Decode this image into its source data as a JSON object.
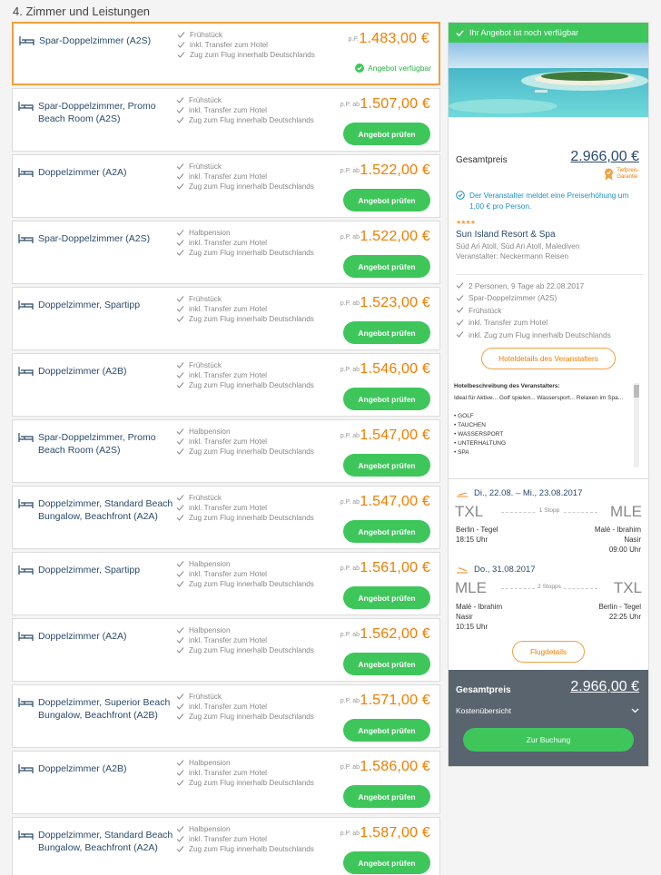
{
  "section_title": "4. Zimmer und Leistungen",
  "offers": [
    {
      "name": "Spar-Doppelzimmer (A2S)",
      "features": [
        "Frühstück",
        "inkl. Transfer zum Hotel",
        "Zug zum Flug innerhalb Deutschlands"
      ],
      "price_note": "p.P.",
      "price": "1.483,00 €",
      "status": "Angebot verfügbar"
    },
    {
      "name": "Spar-Doppelzimmer, Promo Beach Room (A2S)",
      "features": [
        "Frühstück",
        "inkl. Transfer zum Hotel",
        "Zug zum Flug innerhalb Deutschlands"
      ],
      "price_note": "p.P. ab",
      "price": "1.507,00 €",
      "button": "Angebot prüfen"
    },
    {
      "name": "Doppelzimmer (A2A)",
      "features": [
        "Frühstück",
        "inkl. Transfer zum Hotel",
        "Zug zum Flug innerhalb Deutschlands"
      ],
      "price_note": "p.P. ab",
      "price": "1.522,00 €",
      "button": "Angebot prüfen"
    },
    {
      "name": "Spar-Doppelzimmer (A2S)",
      "features": [
        "Halbpension",
        "inkl. Transfer zum Hotel",
        "Zug zum Flug innerhalb Deutschlands"
      ],
      "price_note": "p.P. ab",
      "price": "1.522,00 €",
      "button": "Angebot prüfen"
    },
    {
      "name": "Doppelzimmer, Spartipp",
      "features": [
        "Frühstück",
        "inkl. Transfer zum Hotel",
        "Zug zum Flug innerhalb Deutschlands"
      ],
      "price_note": "p.P. ab",
      "price": "1.523,00 €",
      "button": "Angebot prüfen"
    },
    {
      "name": "Doppelzimmer (A2B)",
      "features": [
        "Frühstück",
        "inkl. Transfer zum Hotel",
        "Zug zum Flug innerhalb Deutschlands"
      ],
      "price_note": "p.P. ab",
      "price": "1.546,00 €",
      "button": "Angebot prüfen"
    },
    {
      "name": "Spar-Doppelzimmer, Promo Beach Room (A2S)",
      "features": [
        "Halbpension",
        "inkl. Transfer zum Hotel",
        "Zug zum Flug innerhalb Deutschlands"
      ],
      "price_note": "p.P. ab",
      "price": "1.547,00 €",
      "button": "Angebot prüfen"
    },
    {
      "name": "Doppelzimmer, Standard Beach Bungalow, Beachfront (A2A)",
      "features": [
        "Frühstück",
        "inkl. Transfer zum Hotel",
        "Zug zum Flug innerhalb Deutschlands"
      ],
      "price_note": "p.P. ab",
      "price": "1.547,00 €",
      "button": "Angebot prüfen"
    },
    {
      "name": "Doppelzimmer, Spartipp",
      "features": [
        "Halbpension",
        "inkl. Transfer zum Hotel",
        "Zug zum Flug innerhalb Deutschlands"
      ],
      "price_note": "p.P. ab",
      "price": "1.561,00 €",
      "button": "Angebot prüfen"
    },
    {
      "name": "Doppelzimmer (A2A)",
      "features": [
        "Halbpension",
        "inkl. Transfer zum Hotel",
        "Zug zum Flug innerhalb Deutschlands"
      ],
      "price_note": "p.P. ab",
      "price": "1.562,00 €",
      "button": "Angebot prüfen"
    },
    {
      "name": "Doppelzimmer, Superior Beach Bungalow, Beachfront (A2B)",
      "features": [
        "Frühstück",
        "inkl. Transfer zum Hotel",
        "Zug zum Flug innerhalb Deutschlands"
      ],
      "price_note": "p.P. ab",
      "price": "1.571,00 €",
      "button": "Angebot prüfen"
    },
    {
      "name": "Doppelzimmer (A2B)",
      "features": [
        "Halbpension",
        "inkl. Transfer zum Hotel",
        "Zug zum Flug innerhalb Deutschlands"
      ],
      "price_note": "p.P. ab",
      "price": "1.586,00 €",
      "button": "Angebot prüfen"
    },
    {
      "name": "Doppelzimmer, Standard Beach Bungalow, Beachfront (A2A)",
      "features": [
        "Halbpension",
        "inkl. Transfer zum Hotel",
        "Zug zum Flug innerhalb Deutschlands"
      ],
      "price_note": "p.P. ab",
      "price": "1.587,00 €",
      "button": "Angebot prüfen"
    }
  ],
  "sidebar": {
    "banner": "Ihr Angebot ist noch verfügbar",
    "total_label": "Gesamtpreis",
    "total_price": "2.966,00 €",
    "badge": [
      "Tiefpreis-",
      "Garantie"
    ],
    "price_notice": "Der Veranstalter meldet eine Preiserhöhung um 1,00 € pro Person.",
    "stars": "★★★★",
    "hotel_name": "Sun Island Resort & Spa",
    "hotel_region": "Süd Ari Atoll, Süd Ari Atoll, Malediven",
    "hotel_operator": "Veranstalter: Neckermann Reisen",
    "summary": [
      "2 Personen, 9 Tage ab 22.08.2017",
      "Spar-Doppelzimmer (A2S)",
      "Frühstück",
      "inkl. Transfer zum Hotel",
      "inkl. Zug zum Flug innerhalb Deutschlands"
    ],
    "hotel_details_button": "Hoteldetails des Veranstalters",
    "description_title": "Hotelbeschreibung des Veranstalters:",
    "description_text": "Ideal für Aktive... Golf spielen... Wassersport... Relaxen im Spa...",
    "description_list": [
      "• GOLF",
      "• TAUCHEN",
      "• WASSERSPORT",
      "• UNTERHALTUNG",
      "• SPA"
    ],
    "outbound": {
      "date": "Di., 22.08. – Mi., 23.08.2017",
      "from_code": "TXL",
      "to_code": "MLE",
      "stops": "1 Stopp",
      "from_city": "Berlin - Tegel",
      "from_time": "18:15 Uhr",
      "to_city_1": "Malé - Ibrahim",
      "to_city_2": "Nasir",
      "to_time": "09:00 Uhr"
    },
    "return": {
      "date": "Do., 31.08.2017",
      "from_code": "MLE",
      "to_code": "TXL",
      "stops": "2 Stopps",
      "from_city_1": "Malé - Ibrahim",
      "from_city_2": "Nasir",
      "from_time": "10:15 Uhr",
      "to_city": "Berlin - Tegel",
      "to_time": "22:25 Uhr"
    },
    "flight_details_button": "Flugdetails",
    "footer": {
      "total_label": "Gesamtpreis",
      "total_price": "2.966,00 €",
      "costs_label": "Kostenübersicht",
      "book_button": "Zur Buchung"
    }
  },
  "colors": {
    "orange": "#f07d00",
    "green": "#3ec65b",
    "navy": "#2b4a6b",
    "footer": "#59646e"
  }
}
